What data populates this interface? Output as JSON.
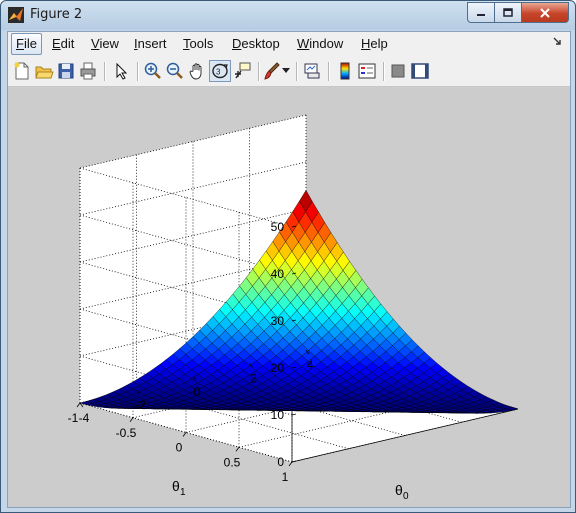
{
  "window": {
    "title": "Figure 2"
  },
  "menubar": {
    "items": [
      {
        "label": "File",
        "mnemonic": "F"
      },
      {
        "label": "Edit",
        "mnemonic": "E"
      },
      {
        "label": "View",
        "mnemonic": "V"
      },
      {
        "label": "Insert",
        "mnemonic": "I"
      },
      {
        "label": "Tools",
        "mnemonic": "T"
      },
      {
        "label": "Desktop",
        "mnemonic": "D"
      },
      {
        "label": "Window",
        "mnemonic": "W"
      },
      {
        "label": "Help",
        "mnemonic": "H"
      }
    ]
  },
  "toolbar": {
    "icons": [
      "new-figure-icon",
      "open-file-icon",
      "save-icon",
      "print-icon",
      "edit-plot-arrow-icon",
      "zoom-in-icon",
      "zoom-out-icon",
      "pan-hand-icon",
      "rotate-3d-icon",
      "data-cursor-icon",
      "brush-icon",
      "brush-dropdown-icon",
      "link-plot-icon",
      "insert-colorbar-icon",
      "insert-legend-icon",
      "hide-plot-tools-icon",
      "show-plot-tools-icon"
    ],
    "active": "rotate-3d-icon"
  },
  "chart_data": {
    "type": "surface",
    "title": "",
    "xlabel": "θ0",
    "ylabel": "θ1",
    "zlabel": "",
    "xlim": [
      -4,
      4
    ],
    "ylim": [
      -1,
      1
    ],
    "zlim": [
      0,
      50
    ],
    "xticks": [
      "-4",
      "-2",
      "0",
      "2",
      "4"
    ],
    "yticks": [
      "-1",
      "-0.5",
      "0",
      "0.5",
      "1"
    ],
    "zticks": [
      "0",
      "10",
      "20",
      "30",
      "40",
      "50"
    ],
    "grid": true,
    "colormap": "jet",
    "surface": {
      "x_range": [
        -4,
        4
      ],
      "y_range": [
        -1,
        1
      ],
      "z_range": [
        0,
        34
      ],
      "peaks_at": [
        [
          -4,
          1
        ],
        [
          4,
          -1
        ]
      ],
      "minimum_along": "diagonal valley from (-4,-1) to (4,1)"
    }
  }
}
